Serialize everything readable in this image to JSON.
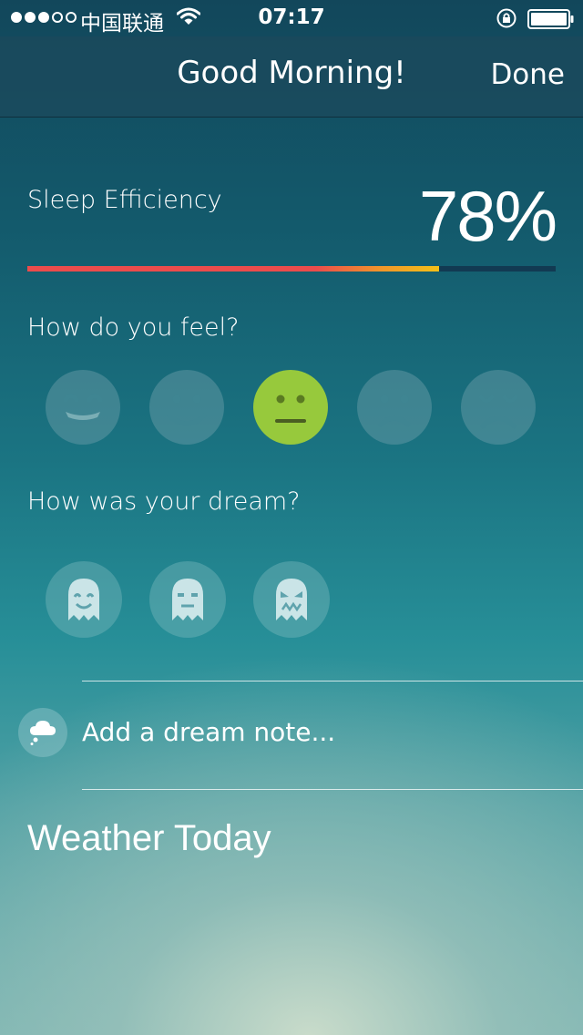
{
  "status_bar": {
    "carrier": "中国联通",
    "time": "07:17",
    "signal_bars_filled": 3,
    "signal_bars_total": 5
  },
  "nav": {
    "title": "Good Morning!",
    "done_label": "Done"
  },
  "sleep": {
    "label": "Sleep Efficiency",
    "value_text": "78%",
    "value_fraction": 0.78
  },
  "feel": {
    "label": "How do you feel?",
    "options": [
      {
        "icon": "very-happy-face-icon"
      },
      {
        "icon": "happy-face-icon"
      },
      {
        "icon": "neutral-face-icon",
        "selected": true
      },
      {
        "icon": "sad-face-icon"
      },
      {
        "icon": "very-sad-face-icon"
      }
    ],
    "selected_color": "#97c93c"
  },
  "dream": {
    "label": "How was your dream?",
    "options": [
      {
        "icon": "happy-ghost-icon"
      },
      {
        "icon": "neutral-ghost-icon"
      },
      {
        "icon": "angry-ghost-icon"
      }
    ]
  },
  "note": {
    "placeholder": "Add a dream note...",
    "icon": "dream-cloud-icon"
  },
  "weather": {
    "title": "Weather Today"
  },
  "colors": {
    "progress_red": "#ec4c4c",
    "progress_yellow": "#f2c018",
    "progress_track": "#123a52"
  }
}
